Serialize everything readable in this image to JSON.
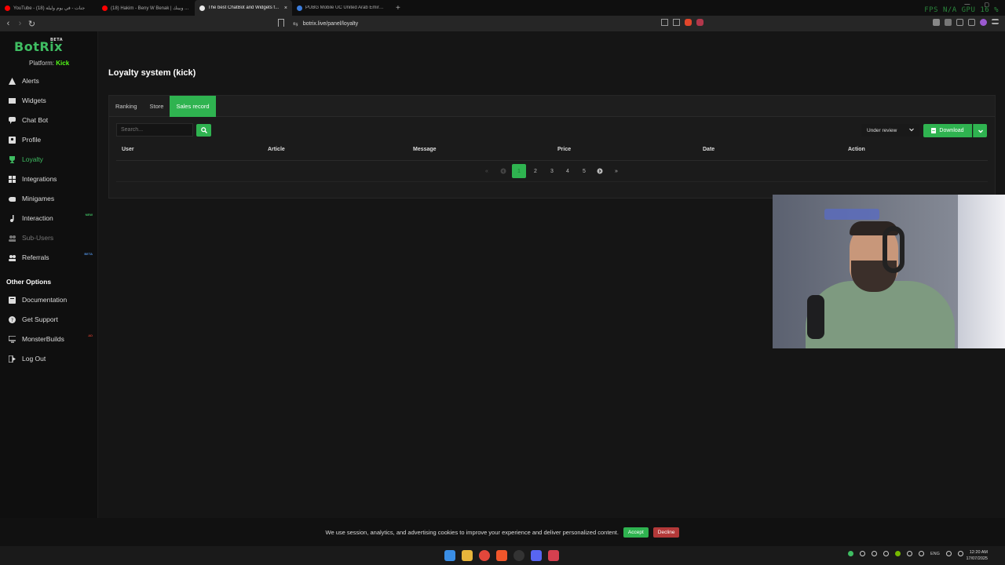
{
  "browser": {
    "tabs": [
      {
        "title": "YouTube - جنات - في يوم وليلة (18)",
        "fav_color": "#ff0000",
        "active": false
      },
      {
        "title": "(18) Hakim - Beny W Benak | وبينك ...",
        "fav_color": "#ff0000",
        "active": false
      },
      {
        "title": "The best ChatBot and Widgets f...",
        "fav_color": "#e8e8e8",
        "active": true
      },
      {
        "title": "PUBG Mobile UC United Arab Emirat...",
        "fav_color": "#3b7ddd",
        "active": false
      }
    ],
    "close_glyph": "×",
    "new_tab_glyph": "+",
    "url": "botrix.live/panel/loyalty",
    "perf": {
      "fps_label": "FPS",
      "fps_value": "N/A",
      "gpu_label": "GPU",
      "gpu_value": "16 %"
    }
  },
  "sidebar": {
    "logo": "BotRix",
    "logo_badge": "BETA",
    "platform_label": "Platform:",
    "platform_value": "Kick",
    "items": [
      {
        "label": "Alerts",
        "icon": "warning-icon",
        "active": false,
        "muted": false,
        "badge": ""
      },
      {
        "label": "Widgets",
        "icon": "widgets-icon",
        "active": false,
        "muted": false,
        "badge": ""
      },
      {
        "label": "Chat Bot",
        "icon": "chat-icon",
        "active": false,
        "muted": false,
        "badge": ""
      },
      {
        "label": "Profile",
        "icon": "profile-icon",
        "active": false,
        "muted": false,
        "badge": ""
      },
      {
        "label": "Loyalty",
        "icon": "trophy-icon",
        "active": true,
        "muted": false,
        "badge": ""
      },
      {
        "label": "Integrations",
        "icon": "integrations-icon",
        "active": false,
        "muted": false,
        "badge": ""
      },
      {
        "label": "Minigames",
        "icon": "gamepad-icon",
        "active": false,
        "muted": false,
        "badge": ""
      },
      {
        "label": "Interaction",
        "icon": "music-icon",
        "active": false,
        "muted": false,
        "badge": "NEW"
      },
      {
        "label": "Sub-Users",
        "icon": "users-icon",
        "active": false,
        "muted": true,
        "badge": ""
      },
      {
        "label": "Referrals",
        "icon": "referrals-icon",
        "active": false,
        "muted": false,
        "badge": "BETA"
      }
    ],
    "other_title": "Other Options",
    "other_items": [
      {
        "label": "Documentation",
        "icon": "book-icon"
      },
      {
        "label": "Get Support",
        "icon": "help-icon"
      },
      {
        "label": "MonsterBuilds",
        "icon": "monitor-icon",
        "badge": "AD"
      },
      {
        "label": "Log Out",
        "icon": "logout-icon"
      }
    ]
  },
  "main": {
    "title": "Loyalty system (kick)",
    "tabs": [
      {
        "label": "Ranking",
        "active": false
      },
      {
        "label": "Store",
        "active": false
      },
      {
        "label": "Sales record",
        "active": true
      }
    ],
    "search_placeholder": "Search...",
    "status_select": "Under review",
    "download_label": "Download",
    "columns": [
      "User",
      "Article",
      "Message",
      "Price",
      "Date",
      "Action"
    ],
    "pagination": {
      "current": "1",
      "pages": [
        "1",
        "2",
        "3",
        "4",
        "5"
      ],
      "first": "«",
      "prev": "‹",
      "next": "›",
      "last": "»"
    }
  },
  "cookie": {
    "message": "We use session, analytics, and advertising cookies to improve your experience and deliver personalized content.",
    "accept": "Accept",
    "decline": "Decline"
  },
  "taskbar": {
    "lang": "ENG",
    "time": "12:20 AM",
    "date": "17/07/2025"
  }
}
